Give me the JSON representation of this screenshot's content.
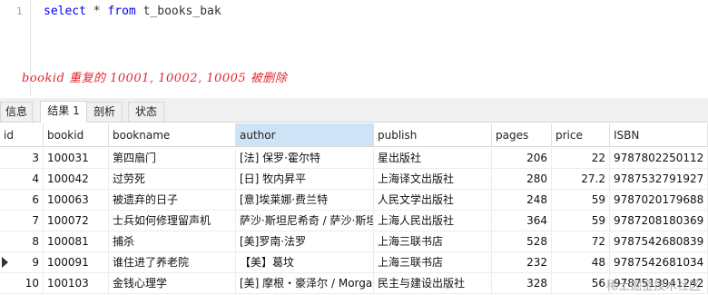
{
  "editor": {
    "line_number": "1",
    "sql": {
      "kw1": "select",
      "star": " * ",
      "kw2": "from",
      "table": " t_books_bak"
    },
    "annotation": "bookid 重复的 10001, 10002, 10005 被删除"
  },
  "tabs": [
    {
      "label": "信息",
      "active": false
    },
    {
      "label": "结果 1",
      "active": true
    },
    {
      "label": "剖析",
      "active": false
    },
    {
      "label": "状态",
      "active": false
    }
  ],
  "grid": {
    "columns": [
      "id",
      "bookid",
      "bookname",
      "author",
      "publish",
      "pages",
      "price",
      "ISBN"
    ],
    "selected_column": "author",
    "current_row_index": 5,
    "rows": [
      [
        "3",
        "100031",
        "第四扇门",
        "[法] 保罗·霍尔特",
        "星出版社",
        "206",
        "22",
        "9787802250112"
      ],
      [
        "4",
        "100042",
        "过劳死",
        "[日] 牧内昇平",
        "上海译文出版社",
        "280",
        "27.2",
        "9787532791927"
      ],
      [
        "6",
        "100063",
        "被遗弃的日子",
        "[意]埃莱娜·费兰特",
        "人民文学出版社",
        "248",
        "59",
        "9787020179688"
      ],
      [
        "7",
        "100072",
        "士兵如何修理留声机",
        "萨沙·斯坦尼希奇 / 萨沙·斯坦",
        "上海人民出版社",
        "364",
        "59",
        "9787208180369"
      ],
      [
        "8",
        "100081",
        "捕杀",
        "[美]罗南·法罗",
        "上海三联书店",
        "528",
        "72",
        "9787542680839"
      ],
      [
        "9",
        "100091",
        "谁住进了养老院",
        "【美】葛坟",
        "上海三联书店",
        "232",
        "48",
        "9787542681034"
      ],
      [
        "10",
        "100103",
        "金钱心理学",
        "[美] 摩根・豪泽尔 / Morga",
        "民主与建设出版社",
        "328",
        "56",
        "9787513941242"
      ]
    ]
  },
  "watermark": "稀土掘金技术社区"
}
